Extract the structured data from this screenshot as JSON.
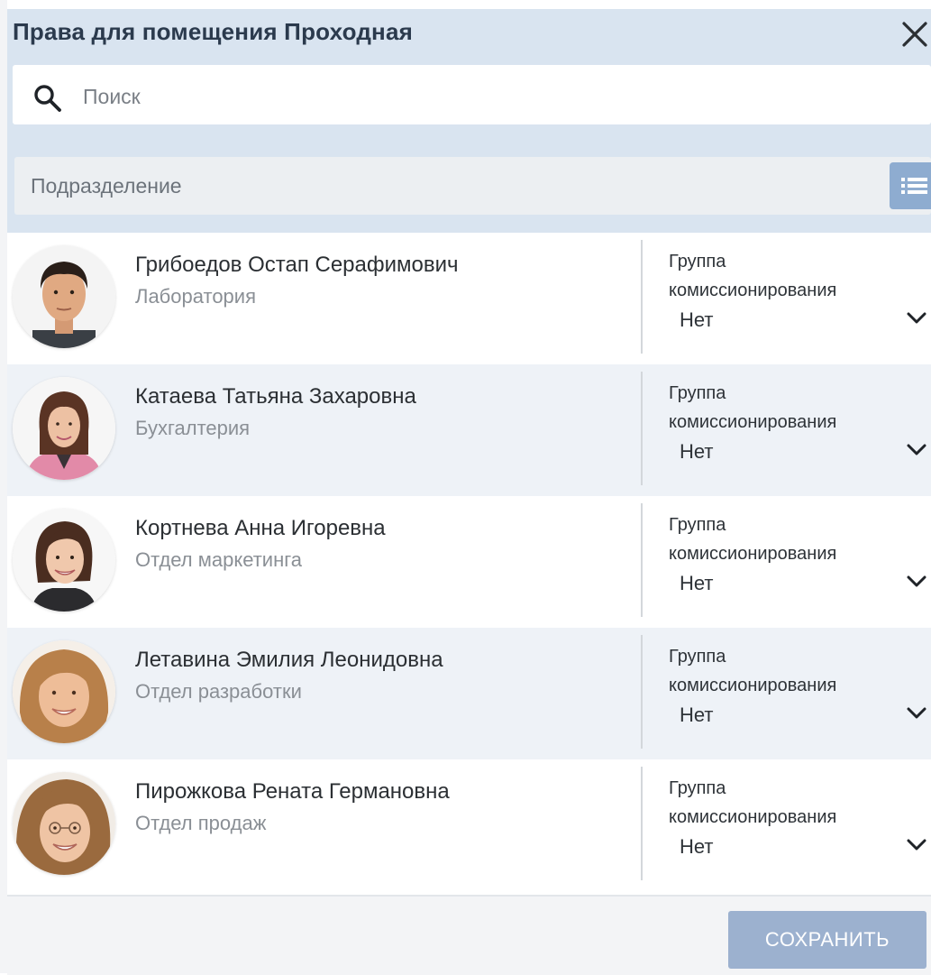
{
  "dialog": {
    "title": "Права для помещения Проходная",
    "close_icon": "close-icon"
  },
  "search": {
    "placeholder": "Поиск",
    "value": "",
    "icon": "search-icon"
  },
  "filter": {
    "department_placeholder": "Подразделение",
    "list_icon": "list-icon"
  },
  "employees": [
    {
      "name": "Грибоедов Остап Серафимович",
      "department": "Лаборатория",
      "group_label": "Группа комиссионирования",
      "group_value": "Нет",
      "photo": "male-portrait"
    },
    {
      "name": "Катаева Татьяна Захаровна",
      "department": "Бухгалтерия",
      "group_label": "Группа комиссионирования",
      "group_value": "Нет",
      "photo": "female-portrait"
    },
    {
      "name": "Кортнева Анна Игоревна",
      "department": "Отдел маркетинга",
      "group_label": "Группа комиссионирования",
      "group_value": "Нет",
      "photo": "female-portrait"
    },
    {
      "name": "Летавина Эмилия Леонидовна",
      "department": "Отдел разработки",
      "group_label": "Группа комиссионирования",
      "group_value": "Нет",
      "photo": "female-portrait"
    },
    {
      "name": "Пирожкова Рената Германовна",
      "department": "Отдел продаж",
      "group_label": "Группа комиссионирования",
      "group_value": "Нет",
      "photo": "female-portrait"
    }
  ],
  "footer": {
    "save_label": "СОХРАНИТЬ"
  },
  "colors": {
    "header_bg": "#d9e4f0",
    "row_alt_bg": "#eef2f7",
    "accent": "#8eacd0",
    "save_button": "#9cb1cf"
  }
}
